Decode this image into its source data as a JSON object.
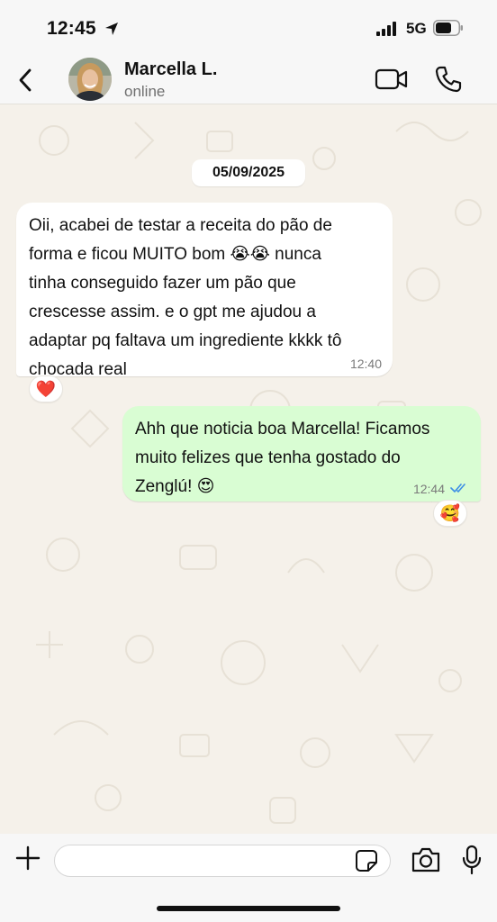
{
  "status_bar": {
    "time": "12:45",
    "network": "5G",
    "icons": [
      "location-arrow-icon",
      "signal-bars-icon",
      "battery-icon"
    ]
  },
  "header": {
    "back_icon": "chevron-left-icon",
    "contact_name": "Marcella L.",
    "contact_status": "online",
    "actions": [
      "video-camera-icon",
      "phone-icon"
    ]
  },
  "chat": {
    "date_label": "05/09/2025",
    "messages": [
      {
        "direction": "incoming",
        "text": "Oii, acabei de testar a receita do pão de\nforma e ficou MUITO bom 😭😭 nunca\ntinha conseguido fazer um pão que\ncrescesse assim. e o gpt me ajudou a\nadaptar pq faltava um ingrediente kkkk tô\nchocada real",
        "time": "12:40",
        "reaction": "❤️"
      },
      {
        "direction": "outgoing",
        "text": "Ahh que noticia boa Marcella! Ficamos\nmuito felizes que tenha gostado do\nZenglú! 😍",
        "time": "12:44",
        "status": "read",
        "reaction": "🥰"
      }
    ]
  },
  "composer": {
    "value": "",
    "icons": [
      "plus-icon",
      "sticker-icon",
      "camera-icon",
      "microphone-icon"
    ]
  },
  "colors": {
    "chat_background": "#f5f1ea",
    "outgoing_bubble": "#d9fdd3",
    "incoming_bubble": "#ffffff",
    "read_ticks": "#3d8ee6"
  }
}
